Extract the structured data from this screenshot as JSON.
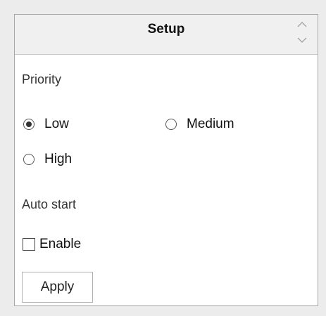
{
  "panel": {
    "title": "Setup"
  },
  "priority": {
    "label": "Priority",
    "options": [
      {
        "label": "Low",
        "selected": true
      },
      {
        "label": "Medium",
        "selected": false
      },
      {
        "label": "High",
        "selected": false
      }
    ]
  },
  "auto_start": {
    "label": "Auto start",
    "checkbox_label": "Enable",
    "checked": false
  },
  "actions": {
    "apply_label": "Apply"
  },
  "icons": {
    "header_toggle": "chevron-up-down-icon"
  }
}
